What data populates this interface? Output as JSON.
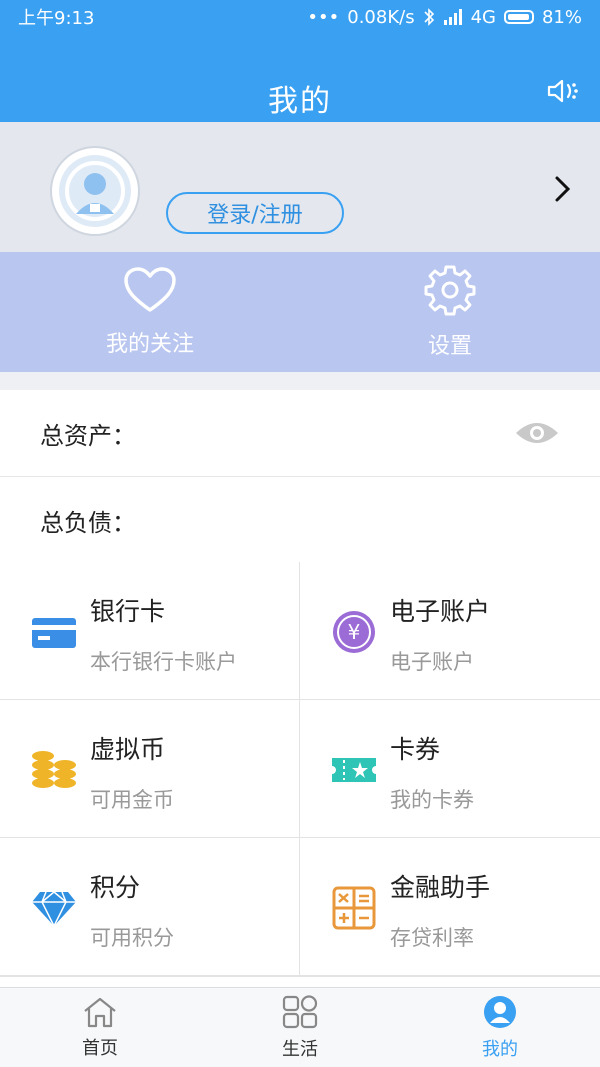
{
  "status_bar": {
    "time": "上午9:13",
    "dots": "•••",
    "network_speed": "0.08K/s",
    "signal": "4G",
    "battery": "81%"
  },
  "header": {
    "title": "我的"
  },
  "profile": {
    "login_label": "登录/注册"
  },
  "quick_actions": [
    {
      "label": "我的关注",
      "icon": "heart-icon"
    },
    {
      "label": "设置",
      "icon": "gear-icon"
    }
  ],
  "assets": {
    "total_assets_label": "总资产：",
    "total_liabilities_label": "总负债："
  },
  "grid": [
    {
      "title": "银行卡",
      "subtitle": "本行银行卡账户",
      "icon": "bank-card-icon",
      "color": "#3a8ee6"
    },
    {
      "title": "电子账户",
      "subtitle": "电子账户",
      "icon": "yuan-coin-icon",
      "color": "#9b6bd6"
    },
    {
      "title": "虚拟币",
      "subtitle": "可用金币",
      "icon": "coin-stack-icon",
      "color": "#f0b429"
    },
    {
      "title": "卡券",
      "subtitle": "我的卡券",
      "icon": "ticket-icon",
      "color": "#2ec4b6"
    },
    {
      "title": "积分",
      "subtitle": "可用积分",
      "icon": "diamond-icon",
      "color": "#2f8fe0"
    },
    {
      "title": "金融助手",
      "subtitle": "存贷利率",
      "icon": "calculator-icon",
      "color": "#e8973a"
    }
  ],
  "tabs": [
    {
      "label": "首页",
      "icon": "home-icon",
      "active": false
    },
    {
      "label": "生活",
      "icon": "grid-icon",
      "active": false
    },
    {
      "label": "我的",
      "icon": "user-icon",
      "active": true
    }
  ],
  "colors": {
    "primary": "#3aa0f2",
    "quick_bg": "#b9c6f0"
  }
}
